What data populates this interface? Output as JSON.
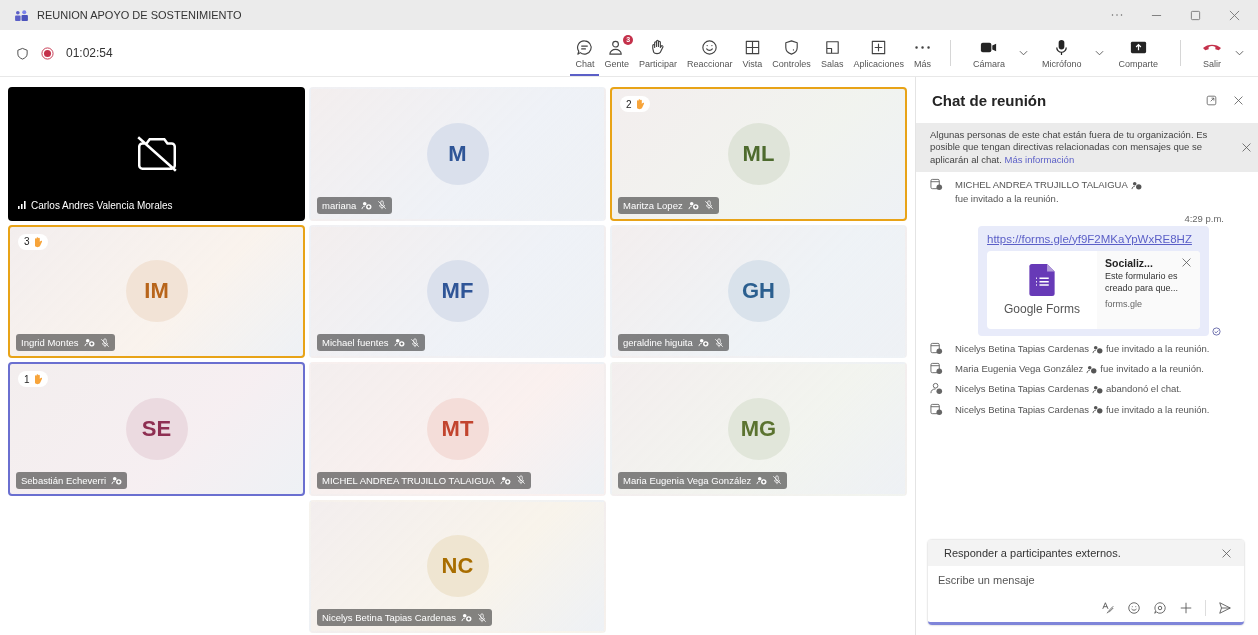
{
  "window": {
    "title": "REUNION APOYO DE SOSTENIMIENTO"
  },
  "toolbar": {
    "timer": "01:02:54",
    "recording": true,
    "tools": [
      {
        "kind": "chat",
        "label": "Chat",
        "selected": true
      },
      {
        "kind": "people",
        "label": "Gente",
        "selected": false,
        "badge": "3"
      },
      {
        "kind": "hand",
        "label": "Participar",
        "selected": false
      },
      {
        "kind": "react",
        "label": "Reaccionar",
        "selected": false
      },
      {
        "kind": "view",
        "label": "Vista",
        "selected": false
      },
      {
        "kind": "controls",
        "label": "Controles",
        "selected": false
      },
      {
        "kind": "rooms",
        "label": "Salas",
        "selected": false
      },
      {
        "kind": "apps",
        "label": "Aplicaciones",
        "selected": false
      },
      {
        "kind": "more",
        "label": "Más",
        "selected": false
      }
    ],
    "devices": [
      {
        "kind": "camera",
        "label": "Cámara",
        "dropdown": true
      },
      {
        "kind": "mic",
        "label": "Micrófono",
        "dropdown": true
      },
      {
        "kind": "share",
        "label": "Comparte",
        "dropdown": false
      }
    ],
    "leave": {
      "label": "Salir"
    }
  },
  "tiles": [
    {
      "kind": "camera_off",
      "name": "Carlos Andres Valencia Morales"
    },
    {
      "kind": "avatar",
      "initials": "M",
      "name": "mariana",
      "color": "#2f5597",
      "muted": true,
      "speaking": false
    },
    {
      "kind": "avatar",
      "initials": "ML",
      "name": "Maritza Lopez",
      "color": "#4e6b2e",
      "muted": true,
      "hand": "2",
      "speaking": false
    },
    {
      "kind": "avatar",
      "initials": "IM",
      "name": "Ingrid Montes",
      "color": "#b8651b",
      "muted": true,
      "hand": "3",
      "speaking": false
    },
    {
      "kind": "avatar",
      "initials": "MF",
      "name": "Michael fuentes",
      "color": "#2f5597",
      "muted": true,
      "speaking": false
    },
    {
      "kind": "avatar",
      "initials": "GH",
      "name": "geraldine higuita",
      "color": "#2b5f8f",
      "muted": true,
      "speaking": false
    },
    {
      "kind": "avatar",
      "initials": "SE",
      "name": "Sebastián Echeverri",
      "color": "#8e2f52",
      "muted": false,
      "hand": "1",
      "speaking": true
    },
    {
      "kind": "avatar",
      "initials": "MT",
      "name": "MICHEL ANDREA TRUJILLO TALAIGUA",
      "color": "#c2442e",
      "muted": true,
      "speaking": false
    },
    {
      "kind": "avatar",
      "initials": "MG",
      "name": "Maria Eugenia Vega González",
      "color": "#5b7330",
      "muted": true,
      "speaking": false
    },
    {
      "kind": "avatar",
      "initials": "NC",
      "name": "Nicelys Betina Tapias Cardenas",
      "color": "#a86d00",
      "muted": true,
      "speaking": false
    }
  ],
  "chat": {
    "title": "Chat de reunión",
    "notice": {
      "text": "Algunas personas de este chat están fuera de tu organización. Es posible que tengan directivas relacionadas con mensajes que se aplicarán al chat.",
      "link": "Más información"
    },
    "messages": [
      {
        "kind": "invited",
        "name": "MICHEL ANDREA TRUJILLO TALAIGUA",
        "text": "fue invitado a la reunión."
      },
      {
        "kind": "time",
        "text": "4:29 p.m."
      },
      {
        "kind": "link",
        "url": "https://forms.gle/yf9F2MKaYpWxRE8HZ",
        "preview": {
          "brand": "Google Forms",
          "title": "Socializ...",
          "description": "Este formulario es creado para que...",
          "domain": "forms.gle"
        }
      },
      {
        "kind": "invited",
        "name": "Nicelys Betina Tapias Cardenas",
        "text": "fue invitado a la reunión."
      },
      {
        "kind": "invited",
        "name": "Maria Eugenia Vega González",
        "text": "fue invitado a la reunión."
      },
      {
        "kind": "left",
        "name": "Nicelys Betina Tapias Cardenas",
        "text": "abandonó el chat."
      },
      {
        "kind": "invited",
        "name": "Nicelys Betina Tapias Cardenas",
        "text": "fue invitado a la reunión."
      }
    ],
    "composer": {
      "banner": "Responder a participantes externos.",
      "placeholder": "Escribe un mensaje"
    }
  }
}
